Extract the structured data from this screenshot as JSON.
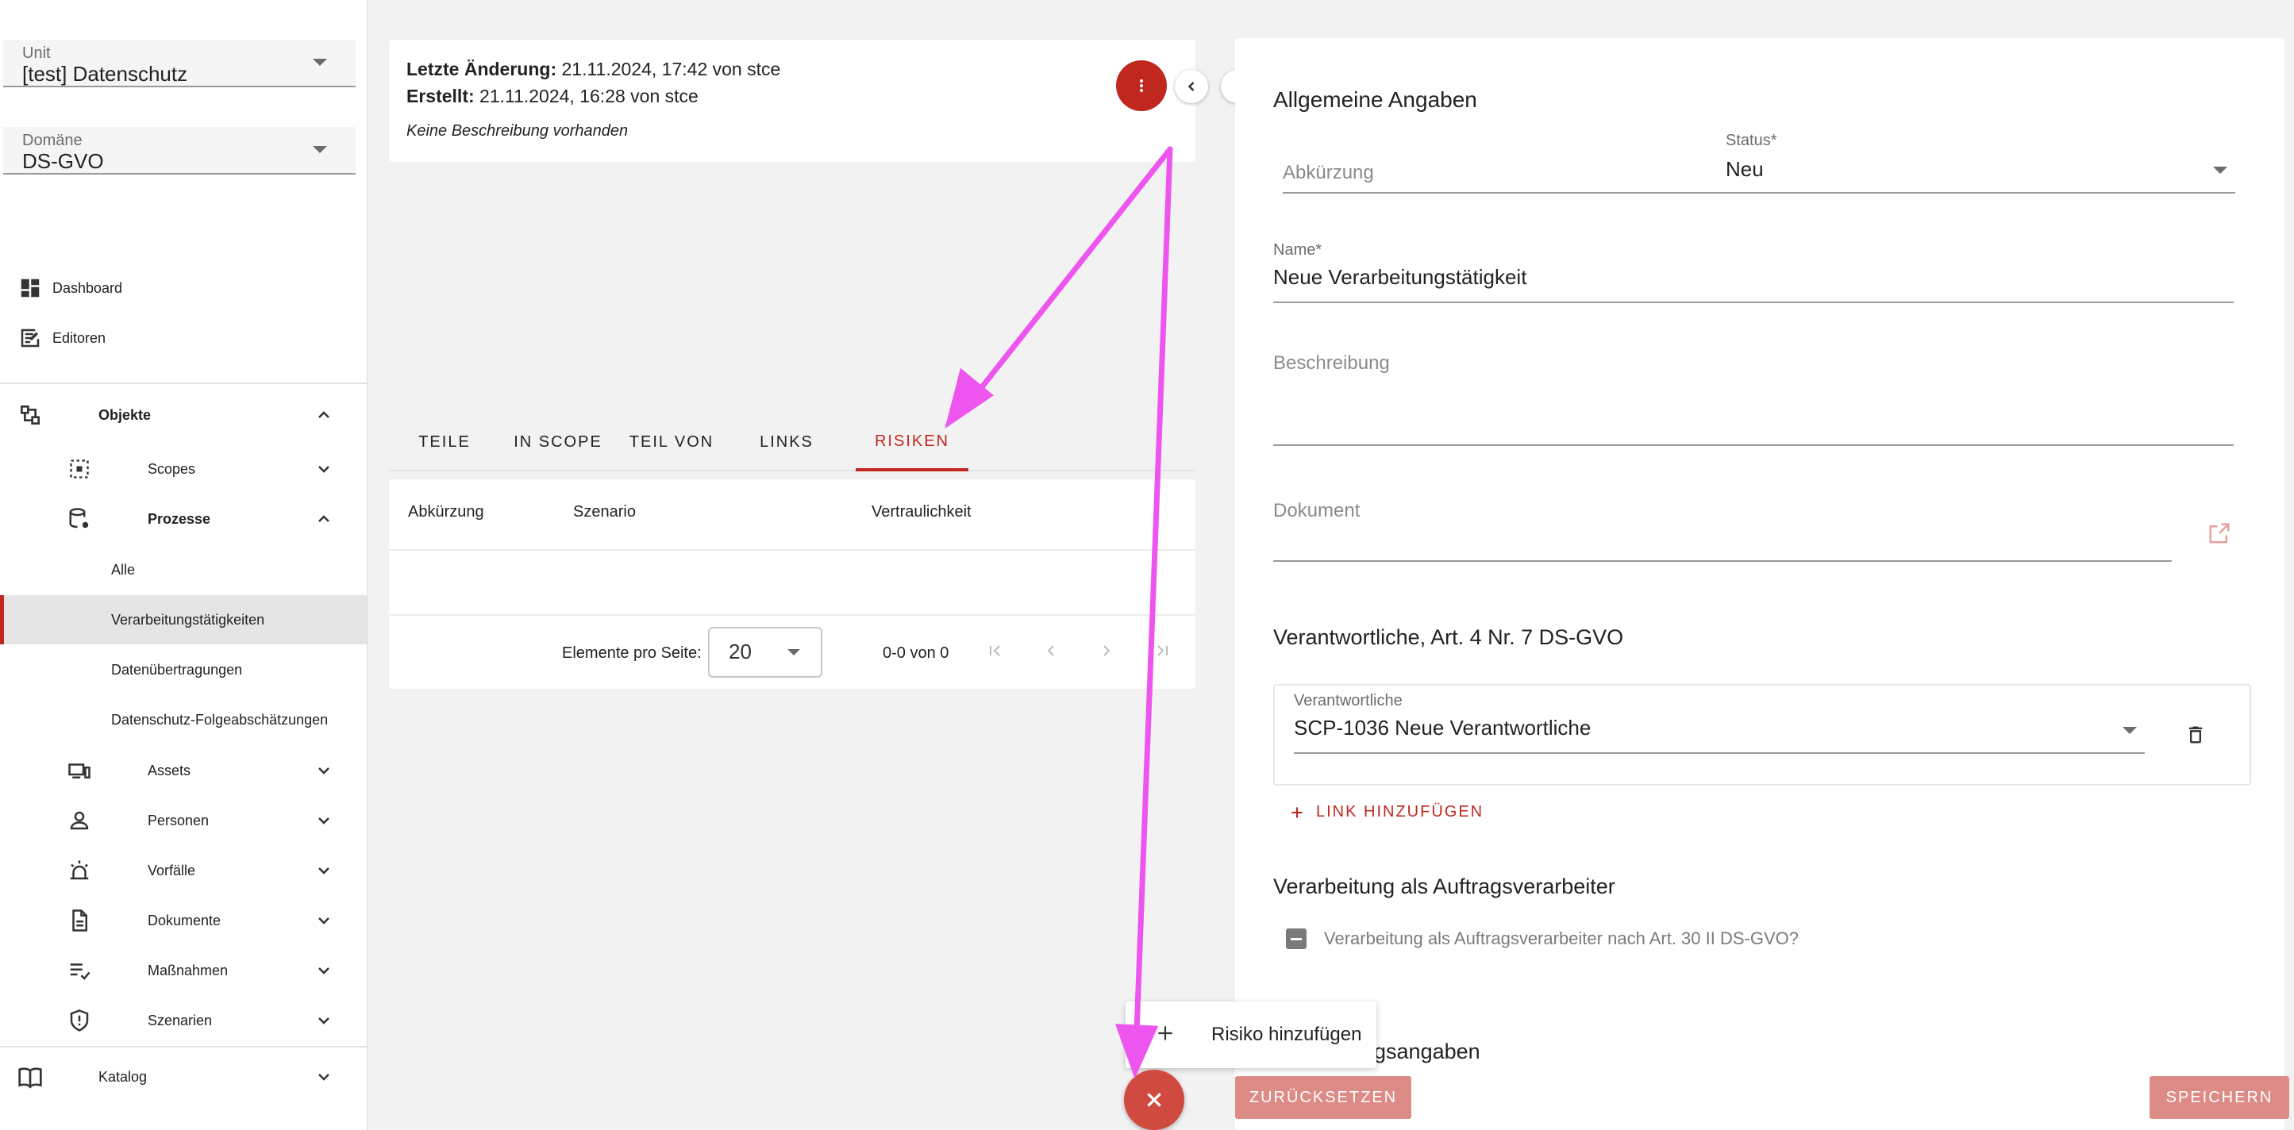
{
  "sidebar": {
    "unit": {
      "label": "Unit",
      "value": "[test] Datenschutz"
    },
    "domain": {
      "label": "Domäne",
      "value": "DS-GVO"
    },
    "dashboard": "Dashboard",
    "editoren": "Editoren",
    "objekte": "Objekte",
    "scopes": "Scopes",
    "prozesse": "Prozesse",
    "alle": "Alle",
    "verarbeitungstaetigkeiten": "Verarbeitungstätigkeiten",
    "datenuebertragungen": "Datenübertragungen",
    "dsfa": "Datenschutz-Folgeabschätzungen",
    "assets": "Assets",
    "personen": "Personen",
    "vorfaelle": "Vorfälle",
    "dokumente": "Dokumente",
    "massnahmen": "Maßnahmen",
    "szenarien": "Szenarien",
    "katalog": "Katalog"
  },
  "info": {
    "changed_label": "Letzte Änderung:",
    "changed_value": "21.11.2024, 17:42 von stce",
    "created_label": "Erstellt:",
    "created_value": "21.11.2024, 16:28 von stce",
    "description": "Keine Beschreibung vorhanden"
  },
  "tabs": [
    "TEILE",
    "IN SCOPE",
    "TEIL VON",
    "LINKS",
    "RISIKEN"
  ],
  "table": {
    "headers": [
      "Abkürzung",
      "Szenario",
      "Vertraulichkeit"
    ],
    "per_page_label": "Elemente pro Seite:",
    "per_page_value": "20",
    "range": "0-0 von 0"
  },
  "form": {
    "general_title": "Allgemeine Angaben",
    "abbreviation_placeholder": "Abkürzung",
    "status_label": "Status*",
    "status_value": "Neu",
    "name_label": "Name*",
    "name_value": "Neue Verarbeitungstätigkeit",
    "description_placeholder": "Beschreibung",
    "document_placeholder": "Dokument",
    "responsible_title": "Verantwortliche, Art. 4 Nr. 7 DS-GVO",
    "responsible_label": "Verantwortliche",
    "responsible_value": "SCP-1036 Neue Verantwortliche",
    "add_link": "LINK HINZUFÜGEN",
    "processor_title": "Verarbeitung als Auftragsverarbeiter",
    "processor_checkbox": "Verarbeitung als Auftragsverarbeiter nach Art. 30 II DS-GVO?",
    "next_section_partial": "ngsangaben"
  },
  "buttons": {
    "reset": "ZURÜCKSETZEN",
    "save": "SPEICHERN"
  },
  "speed_dial": {
    "add_risk": "Risiko hinzufügen"
  },
  "colors": {
    "accent": "#c0271f",
    "annotation": "#ee55ee"
  }
}
